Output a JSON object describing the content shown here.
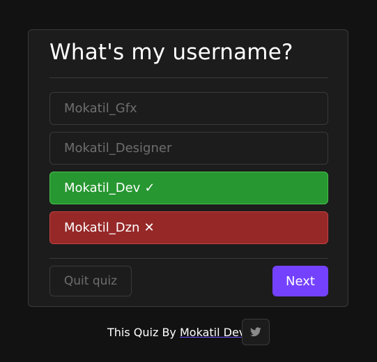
{
  "quiz": {
    "question": "What's my username?",
    "options": [
      {
        "label": "Mokatil_Gfx",
        "state": "neutral",
        "mark": ""
      },
      {
        "label": "Mokatil_Designer",
        "state": "neutral",
        "mark": ""
      },
      {
        "label": "Mokatil_Dev",
        "state": "correct",
        "mark": "✓"
      },
      {
        "label": "Mokatil_Dzn",
        "state": "wrong",
        "mark": "✕"
      }
    ],
    "quit_label": "Quit quiz",
    "next_label": "Next"
  },
  "footer": {
    "prefix": "This Quiz By",
    "author": "Mokatil Dev",
    "social_icon": "twitter-icon"
  },
  "colors": {
    "background": "#121212",
    "card": "#1c1c1c",
    "border": "#3a3a3a",
    "correct": "#279731",
    "wrong": "#962828",
    "accent": "#7442ff"
  }
}
